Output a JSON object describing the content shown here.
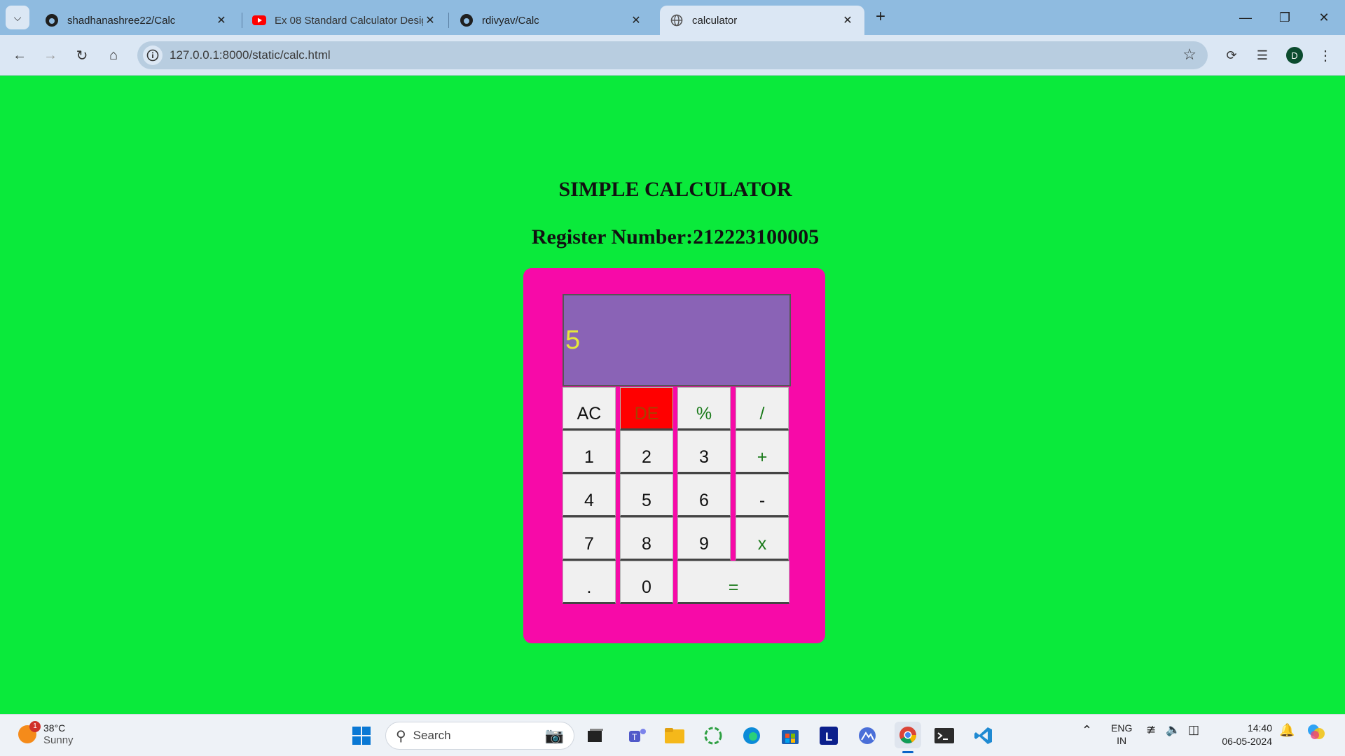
{
  "browser": {
    "tabs": [
      {
        "title": "shadhanashree22/Calc",
        "icon": "github-icon",
        "active": false
      },
      {
        "title": "Ex 08 Standard Calculator Desig",
        "icon": "youtube-icon",
        "active": false
      },
      {
        "title": "rdivyav/Calc",
        "icon": "github-icon",
        "active": false
      },
      {
        "title": "calculator",
        "icon": "globe-icon",
        "active": true
      }
    ],
    "new_tab": "+",
    "url": "127.0.0.1:8000/static/calc.html",
    "profile_initial": "D",
    "colors": {
      "tabstrip": "#8fbbe0",
      "toolbar": "#dbe7f4"
    }
  },
  "page": {
    "title": "SIMPLE CALCULATOR",
    "register_line": "Register Number:212223100005",
    "background": "#0aea3b"
  },
  "calculator": {
    "display_value": "5",
    "colors": {
      "body": "#f70aa8",
      "display": "#8a63b6",
      "display_text": "#e6e83a",
      "de_key": "#ff0000"
    },
    "keys": {
      "ac": "AC",
      "de": "DE",
      "percent": "%",
      "divide": "/",
      "one": "1",
      "two": "2",
      "three": "3",
      "plus": "+",
      "four": "4",
      "five": "5",
      "six": "6",
      "minus": "-",
      "seven": "7",
      "eight": "8",
      "nine": "9",
      "multiply": "x",
      "dot": ".",
      "zero": "0",
      "equals": "="
    }
  },
  "taskbar": {
    "weather": {
      "badge": "1",
      "temp": "38°C",
      "condition": "Sunny"
    },
    "search_placeholder": "Search",
    "lang_top": "ENG",
    "lang_bottom": "IN",
    "time": "14:40",
    "date": "06-05-2024"
  }
}
